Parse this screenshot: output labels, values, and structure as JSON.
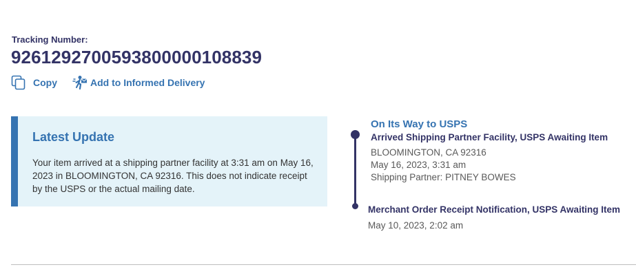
{
  "tracking": {
    "label": "Tracking Number:",
    "number": "9261292700593800000108839",
    "copy_label": "Copy",
    "informed_delivery_label": "Add to Informed Delivery"
  },
  "latest_update": {
    "title": "Latest Update",
    "body": "Your item arrived at a shipping partner facility at 3:31 am on May 16, 2023 in BLOOMINGTON, CA 92316. This does not indicate receipt by the USPS or the actual mailing date."
  },
  "timeline": {
    "status_title": "On Its Way to USPS",
    "events": [
      {
        "title": "Arrived Shipping Partner Facility, USPS Awaiting Item",
        "location": "BLOOMINGTON, CA 92316",
        "datetime": "May 16, 2023, 3:31 am",
        "partner": "Shipping Partner: PITNEY BOWES"
      },
      {
        "title": "Merchant Order Receipt Notification, USPS Awaiting Item",
        "datetime": "May 10, 2023, 2:02 am"
      }
    ]
  },
  "icons": {
    "copy": "copy-icon",
    "informed_delivery": "mail-carrier-icon"
  },
  "colors": {
    "navy": "#333366",
    "link_blue": "#3573b1",
    "update_bg": "#e4f3f9"
  }
}
